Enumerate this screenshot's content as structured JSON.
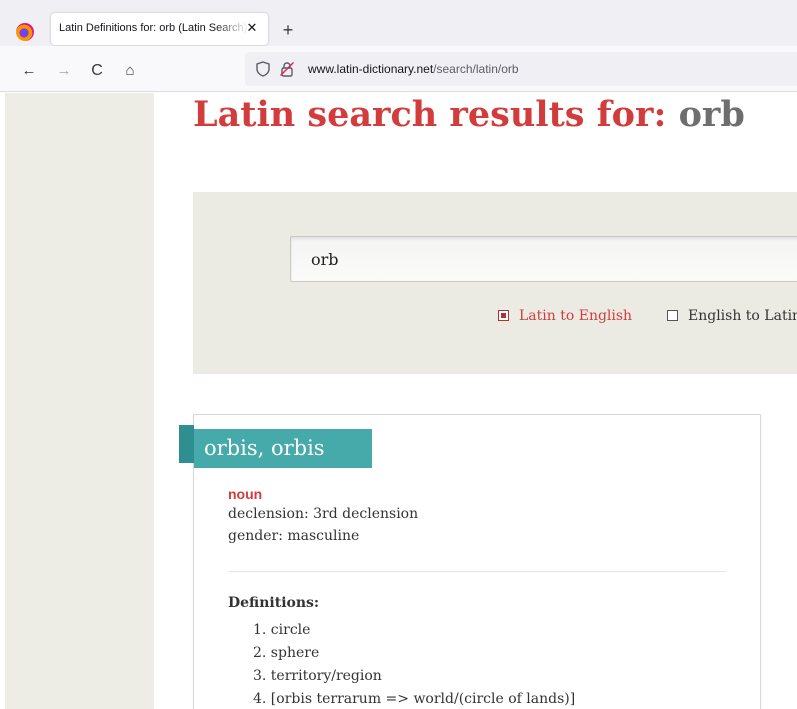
{
  "browser": {
    "tab_title": "Latin Definitions for: orb (Latin Search)",
    "tab_close": "✕",
    "new_tab": "+",
    "url_host": "www.latin-dictionary.net",
    "url_path": "/search/latin/orb"
  },
  "nav": {
    "back": "←",
    "forward": "→",
    "reload": "C",
    "home": "⌂"
  },
  "page": {
    "title_prefix": "Latin search results for:",
    "title_query": "orb"
  },
  "search": {
    "value": "orb",
    "options": [
      {
        "label": "Latin to English",
        "checked": true
      },
      {
        "label": "English to Latin",
        "checked": false
      }
    ]
  },
  "result": {
    "headword": "orbis, orbis",
    "part_of_speech": "noun",
    "declension": "declension: 3rd declension",
    "gender": "gender: masculine",
    "definitions_heading": "Definitions:",
    "definitions": [
      "1. circle",
      "2. sphere",
      "3. territory/region",
      "4. [orbis terrarum => world/(circle of lands)]"
    ]
  },
  "colors": {
    "accent_red": "#d33c3c",
    "ribbon_teal": "#47aaaa",
    "ribbon_fold": "#2f8e8f",
    "panel_bg": "#ebebe4"
  }
}
